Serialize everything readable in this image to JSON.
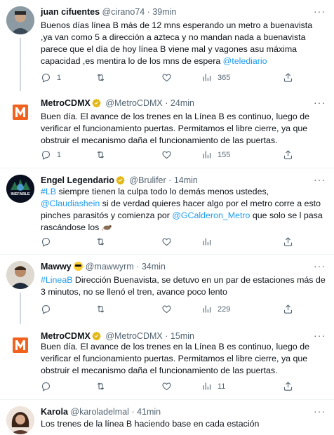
{
  "tweets": [
    {
      "name": "juan cifuentes",
      "handle": "@cirano74",
      "time": "39min",
      "text_parts": [
        "Buenos días línea B más de 12 mns esperando un metro a buenavista ,ya van como 5 a dirección a azteca y no mandan nada a buenavista parece que el día de hoy línea B viene mal y vagones asu máxima capacidad ,es mentira lo de los mns de espera ",
        "@telediario"
      ],
      "replies": "1",
      "retweets": "",
      "likes": "",
      "views": "365"
    },
    {
      "name": "MetroCDMX",
      "handle": "@MetroCDMX",
      "time": "24min",
      "text_parts": [
        "Buen día. El avance de los trenes en la Línea B es continuo, luego de verificar el funcionamiento puertas. Permitamos el libre cierre, ya que obstruir el mecanismo daña el funcionamiento de las puertas."
      ],
      "replies": "1",
      "retweets": "",
      "likes": "",
      "views": "155"
    },
    {
      "name": "Engel Legendario",
      "handle": "@Brulifer",
      "time": "14min",
      "text_parts": [
        "#LB",
        " siempre tienen la culpa todo lo demás menos ustedes, ",
        "@Claudiashein",
        " si de verdad quieres hacer algo por el metro corre a esto pinches parasitós y comienza por ",
        "@GCalderon_Metro",
        " que solo se l pasa rascándose los "
      ],
      "replies": "",
      "retweets": "",
      "likes": "",
      "views": "",
      "avatar_text": "INEFABLE"
    },
    {
      "name": "Mawwy",
      "handle": "@mawwyrm",
      "time": "34min",
      "text_parts": [
        "#LineaB",
        " Dirección Buenavista, se detuvo en un par de estaciones más de 3 minutos, no se llenó el tren, avance poco lento"
      ],
      "replies": "",
      "retweets": "",
      "likes": "",
      "views": "229"
    },
    {
      "name": "MetroCDMX",
      "handle": "@MetroCDMX",
      "time": "15min",
      "text_parts": [
        "Buen día. El avance de los trenes en la Línea B es continuo, luego de verificar el funcionamiento puertas. Permitamos el libre cierre, ya que obstruir el mecanismo daña el funcionamiento de las puertas."
      ],
      "replies": "",
      "retweets": "",
      "likes": "",
      "views": "11"
    },
    {
      "name": "Karola",
      "handle": "@karoladelmal",
      "time": "41min",
      "text_parts": [
        "Los trenes de la línea B haciendo base en cada estación"
      ]
    }
  ],
  "separator": "·",
  "more_glyph": "···",
  "colors": {
    "link": "#1d9bf0",
    "secondary": "#536471",
    "metro_orange": "#f2621f",
    "verified_gold": "#e2b719"
  }
}
